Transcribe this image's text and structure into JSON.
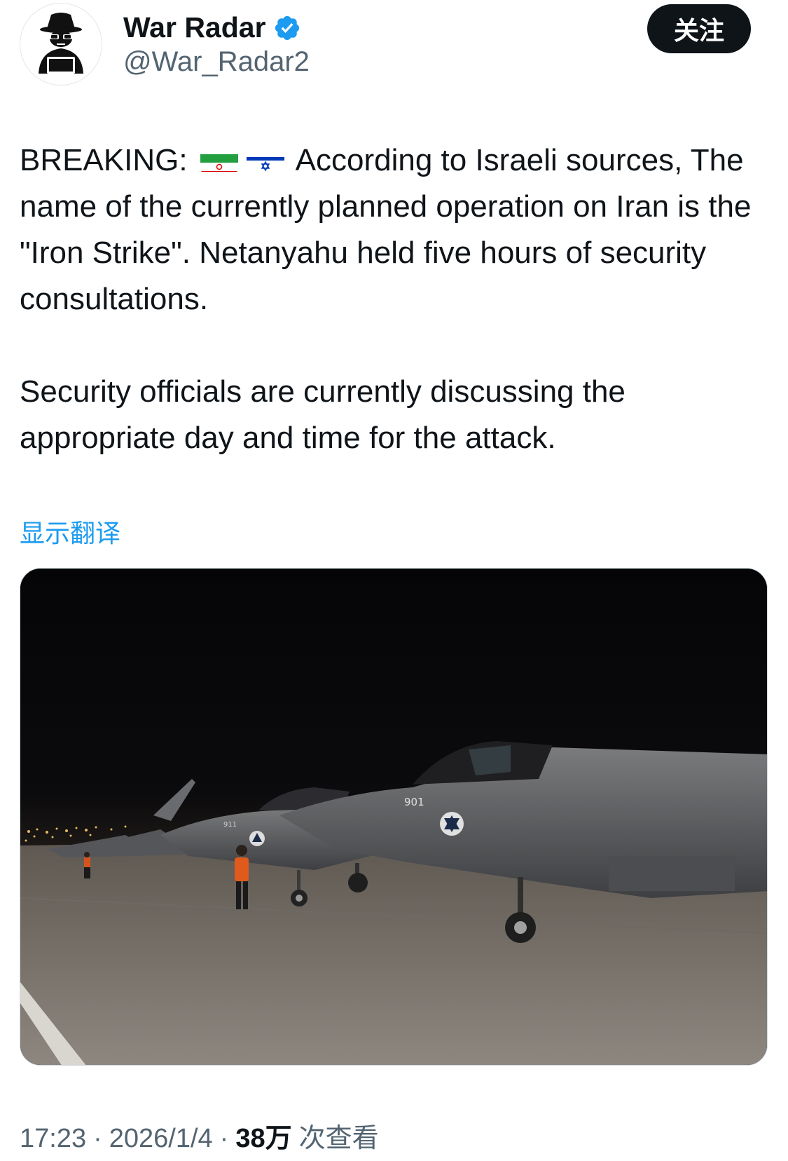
{
  "author": {
    "display_name": "War Radar",
    "handle": "@War_Radar2",
    "avatar_icon": "hacker-avatar-icon",
    "verified_icon": "verified-badge-icon",
    "verified_color": "#1d9bf0"
  },
  "follow_button": {
    "label": "关注"
  },
  "tweet": {
    "paragraph1_before_flags": "BREAKING: ",
    "flags": [
      "iran-flag-icon",
      "israel-flag-icon"
    ],
    "paragraph1_after_flags": " According to Israeli sources, The name of the currently planned operation on Iran is the \"Iron Strike\". Netanyahu held five hours of security consultations.",
    "paragraph2": "Security officials are currently discussing the appropriate day and time for the attack."
  },
  "translate_link": "显示翻译",
  "media": {
    "description_icon": "fighter-jets-photo",
    "aircraft_number_1": "901",
    "aircraft_number_2": "911"
  },
  "meta": {
    "time": "17:23",
    "separator": "·",
    "date": "2026/1/4",
    "views_count": "38万",
    "views_label": "次查看"
  },
  "colors": {
    "accent": "#1d9bf0",
    "text": "#0f1419",
    "secondary": "#536471"
  }
}
